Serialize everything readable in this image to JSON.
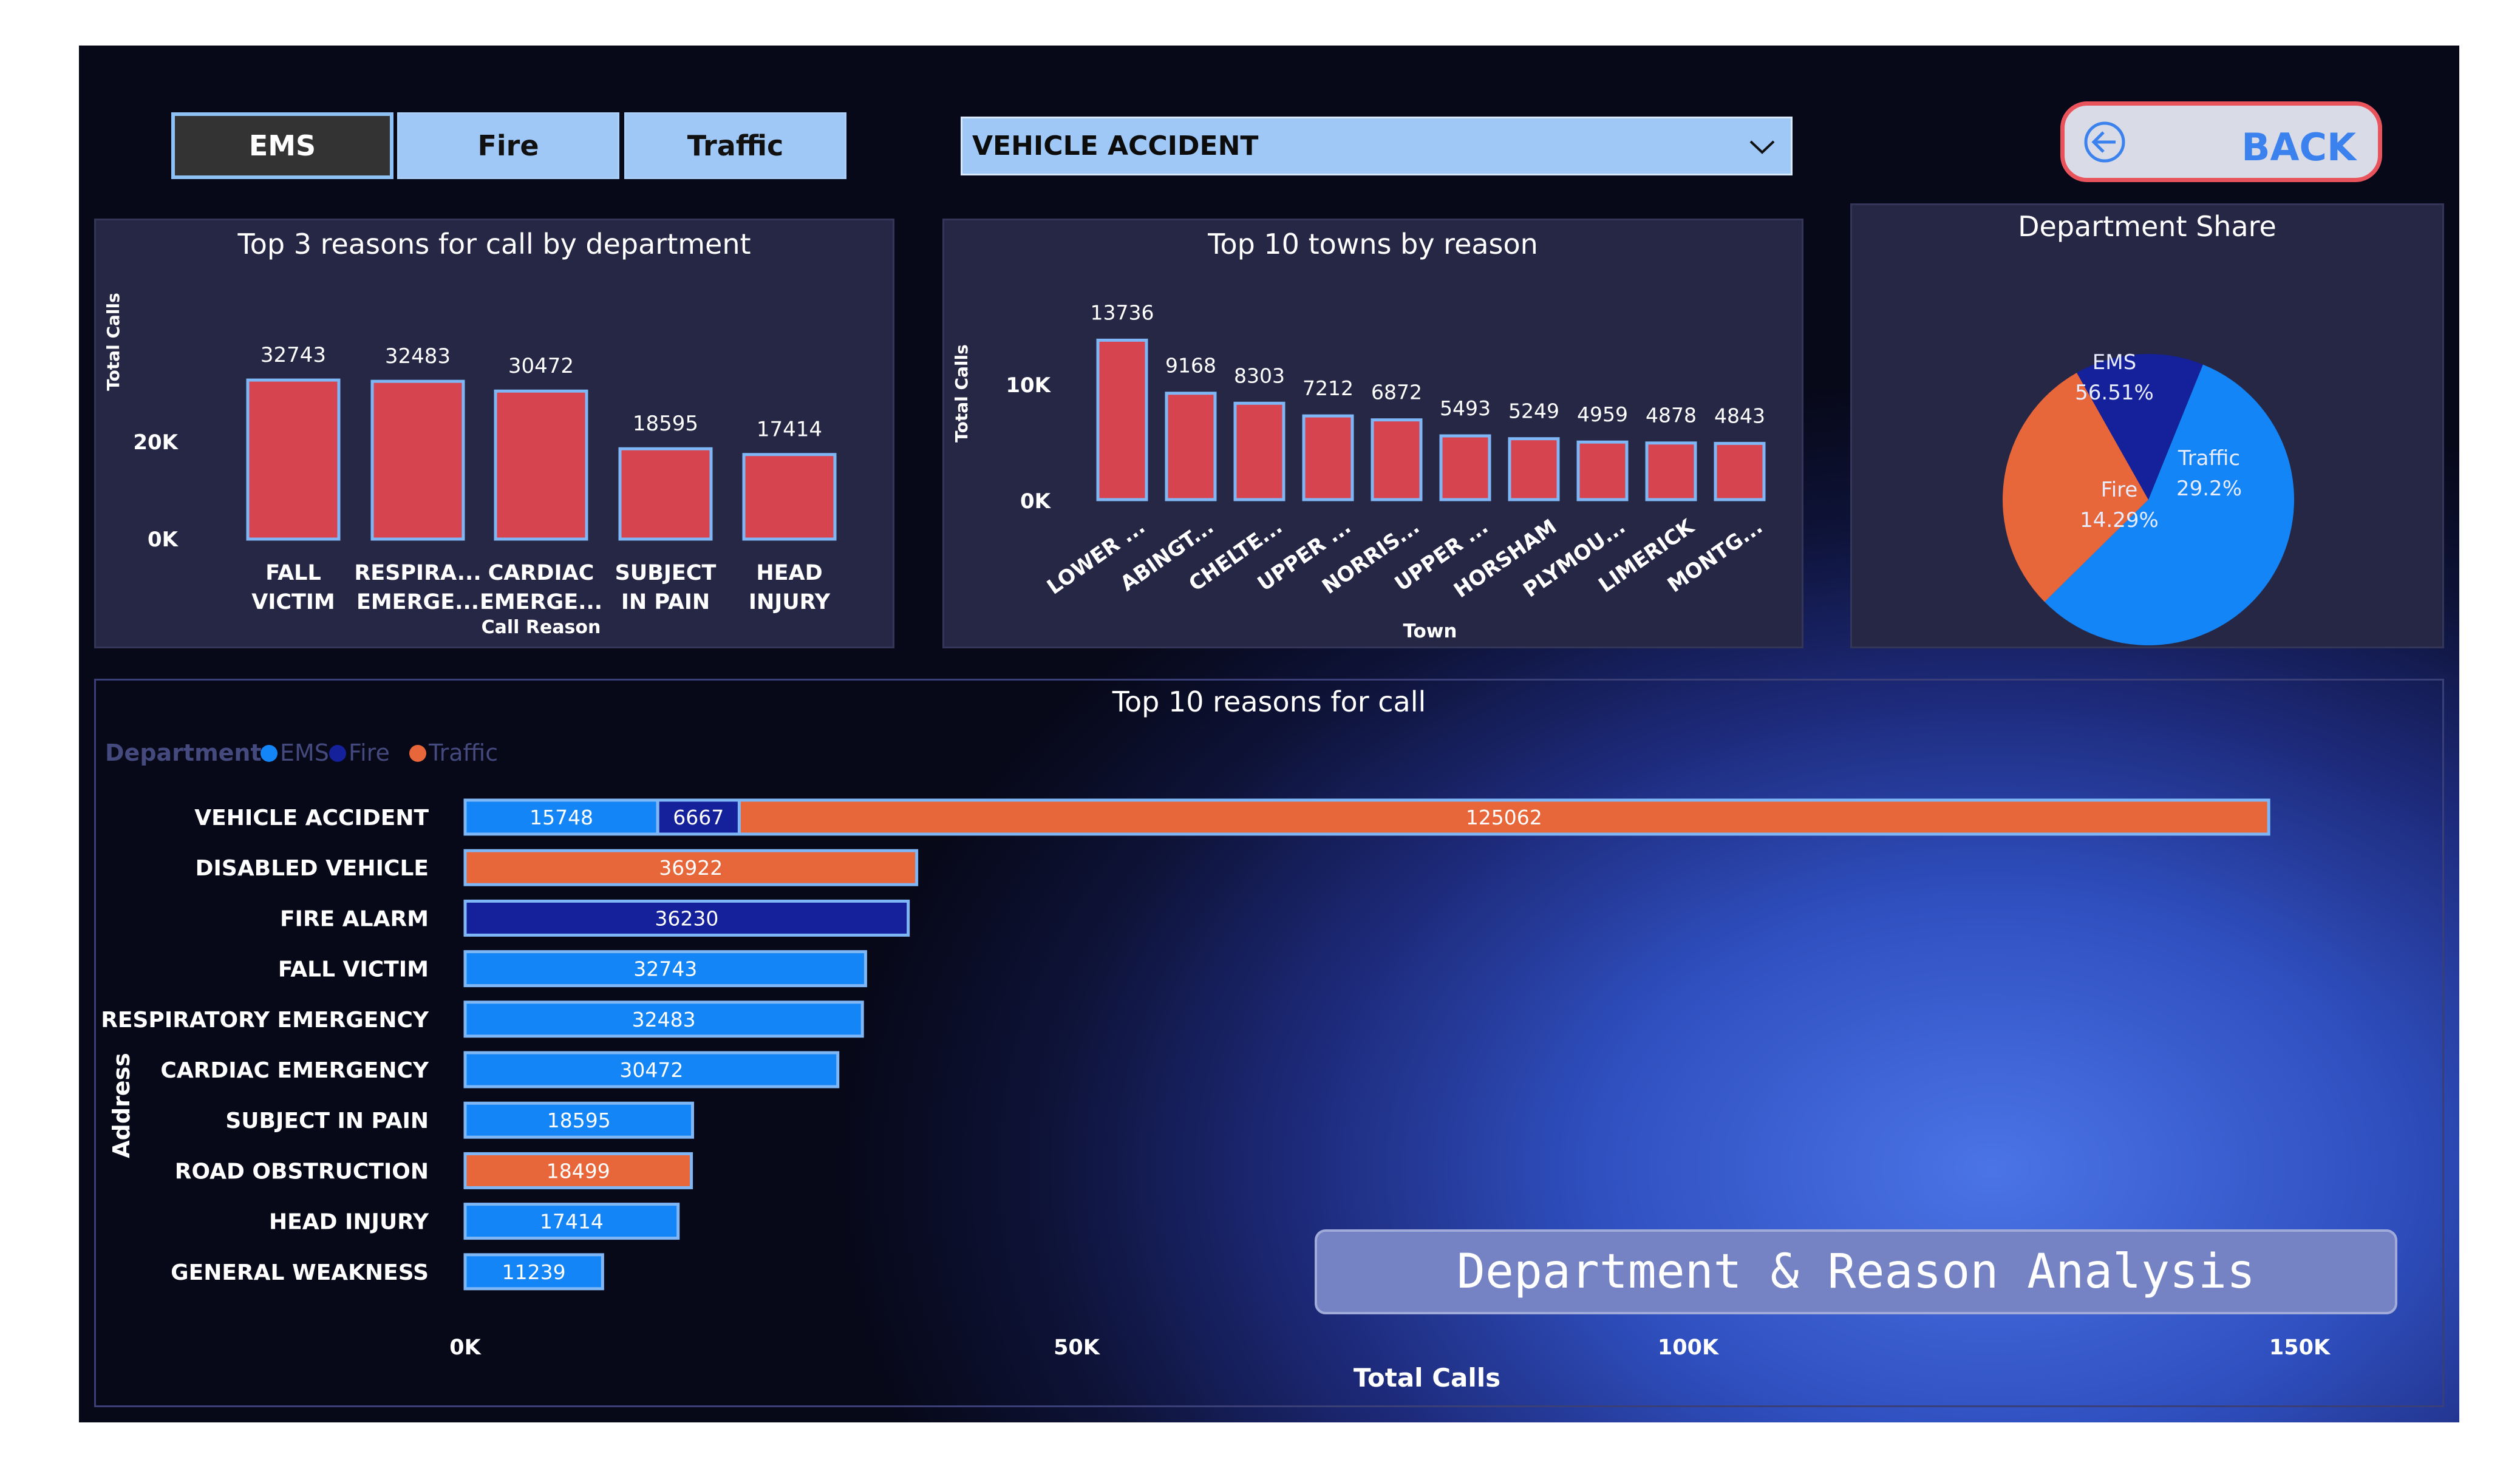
{
  "dept_tabs": [
    {
      "label": "EMS",
      "active": true
    },
    {
      "label": "Fire",
      "active": false
    },
    {
      "label": "Traffic",
      "active": false
    }
  ],
  "reason_filter": {
    "selected": "VEHICLE ACCIDENT",
    "icon": "chevron-down-icon"
  },
  "back_button": {
    "label": "BACK",
    "icon": "arrow-left-circle-icon"
  },
  "colors": {
    "ems": "#1385f6",
    "fire": "#14219a",
    "traffic": "#e8673a",
    "bar_red": "#d5444f",
    "bar_outline": "#7fb6f5"
  },
  "panels": {
    "top3": {
      "title": "Top 3 reasons for call by department"
    },
    "towns": {
      "title": "Top 10 towns by reason"
    },
    "share": {
      "title": "Department Share"
    },
    "top10": {
      "title": "Top 10 reasons for call"
    }
  },
  "banner": {
    "text": "Department & Reason Analysis"
  },
  "chart_data": [
    {
      "type": "bar",
      "title": "Top 3 reasons for call by department",
      "xlabel": "Call Reason",
      "ylabel": "Total Calls",
      "y_ticks": [
        "0K",
        "20K"
      ],
      "ylim": [
        0,
        40000
      ],
      "categories": [
        [
          "FALL",
          "VICTIM"
        ],
        [
          "RESPIRA...",
          "EMERGE..."
        ],
        [
          "CARDIAC",
          "EMERGE..."
        ],
        [
          "SUBJECT",
          "IN PAIN"
        ],
        [
          "HEAD",
          "INJURY"
        ]
      ],
      "values": [
        32743,
        32483,
        30472,
        18595,
        17414
      ]
    },
    {
      "type": "bar",
      "title": "Top 10 towns by reason",
      "xlabel": "Town",
      "ylabel": "Total Calls",
      "y_ticks": [
        "0K",
        "10K"
      ],
      "ylim": [
        0,
        17000
      ],
      "categories": [
        "LOWER ...",
        "ABINGT...",
        "CHELTE...",
        "UPPER ...",
        "NORRIS...",
        "UPPER ...",
        "HORSHAM",
        "PLYMOU...",
        "LIMERICK",
        "MONTG..."
      ],
      "values": [
        13736,
        9168,
        8303,
        7212,
        6872,
        5493,
        5249,
        4959,
        4878,
        4843
      ]
    },
    {
      "type": "pie",
      "title": "Department Share",
      "slices": [
        {
          "name": "EMS",
          "label": "56.51%",
          "value": 56.51,
          "color": "#1385f6"
        },
        {
          "name": "Traffic",
          "label": "29.2%",
          "value": 29.2,
          "color": "#e8673a"
        },
        {
          "name": "Fire",
          "label": "14.29%",
          "value": 14.29,
          "color": "#14219a"
        }
      ]
    },
    {
      "type": "bar",
      "orientation": "horizontal",
      "stacked": true,
      "title": "Top 10 reasons for call",
      "xlabel": "Total Calls",
      "ylabel": "Address",
      "legend_title": "Department",
      "legend": [
        "EMS",
        "Fire",
        "Traffic"
      ],
      "legend_position": "top-left",
      "x_ticks": [
        "0K",
        "50K",
        "100K",
        "150K"
      ],
      "xlim": [
        0,
        150000
      ],
      "categories": [
        "VEHICLE ACCIDENT",
        "DISABLED VEHICLE",
        "FIRE ALARM",
        "FALL VICTIM",
        "RESPIRATORY EMERGENCY",
        "CARDIAC EMERGENCY",
        "SUBJECT IN PAIN",
        "ROAD OBSTRUCTION",
        "HEAD INJURY",
        "GENERAL WEAKNESS"
      ],
      "series": [
        {
          "name": "EMS",
          "values": [
            15748,
            null,
            null,
            32743,
            32483,
            30472,
            18595,
            null,
            17414,
            11239
          ]
        },
        {
          "name": "Fire",
          "values": [
            6667,
            null,
            36230,
            null,
            null,
            null,
            null,
            null,
            null,
            null
          ]
        },
        {
          "name": "Traffic",
          "values": [
            125062,
            36922,
            null,
            null,
            null,
            null,
            null,
            18499,
            null,
            null
          ]
        }
      ]
    }
  ]
}
